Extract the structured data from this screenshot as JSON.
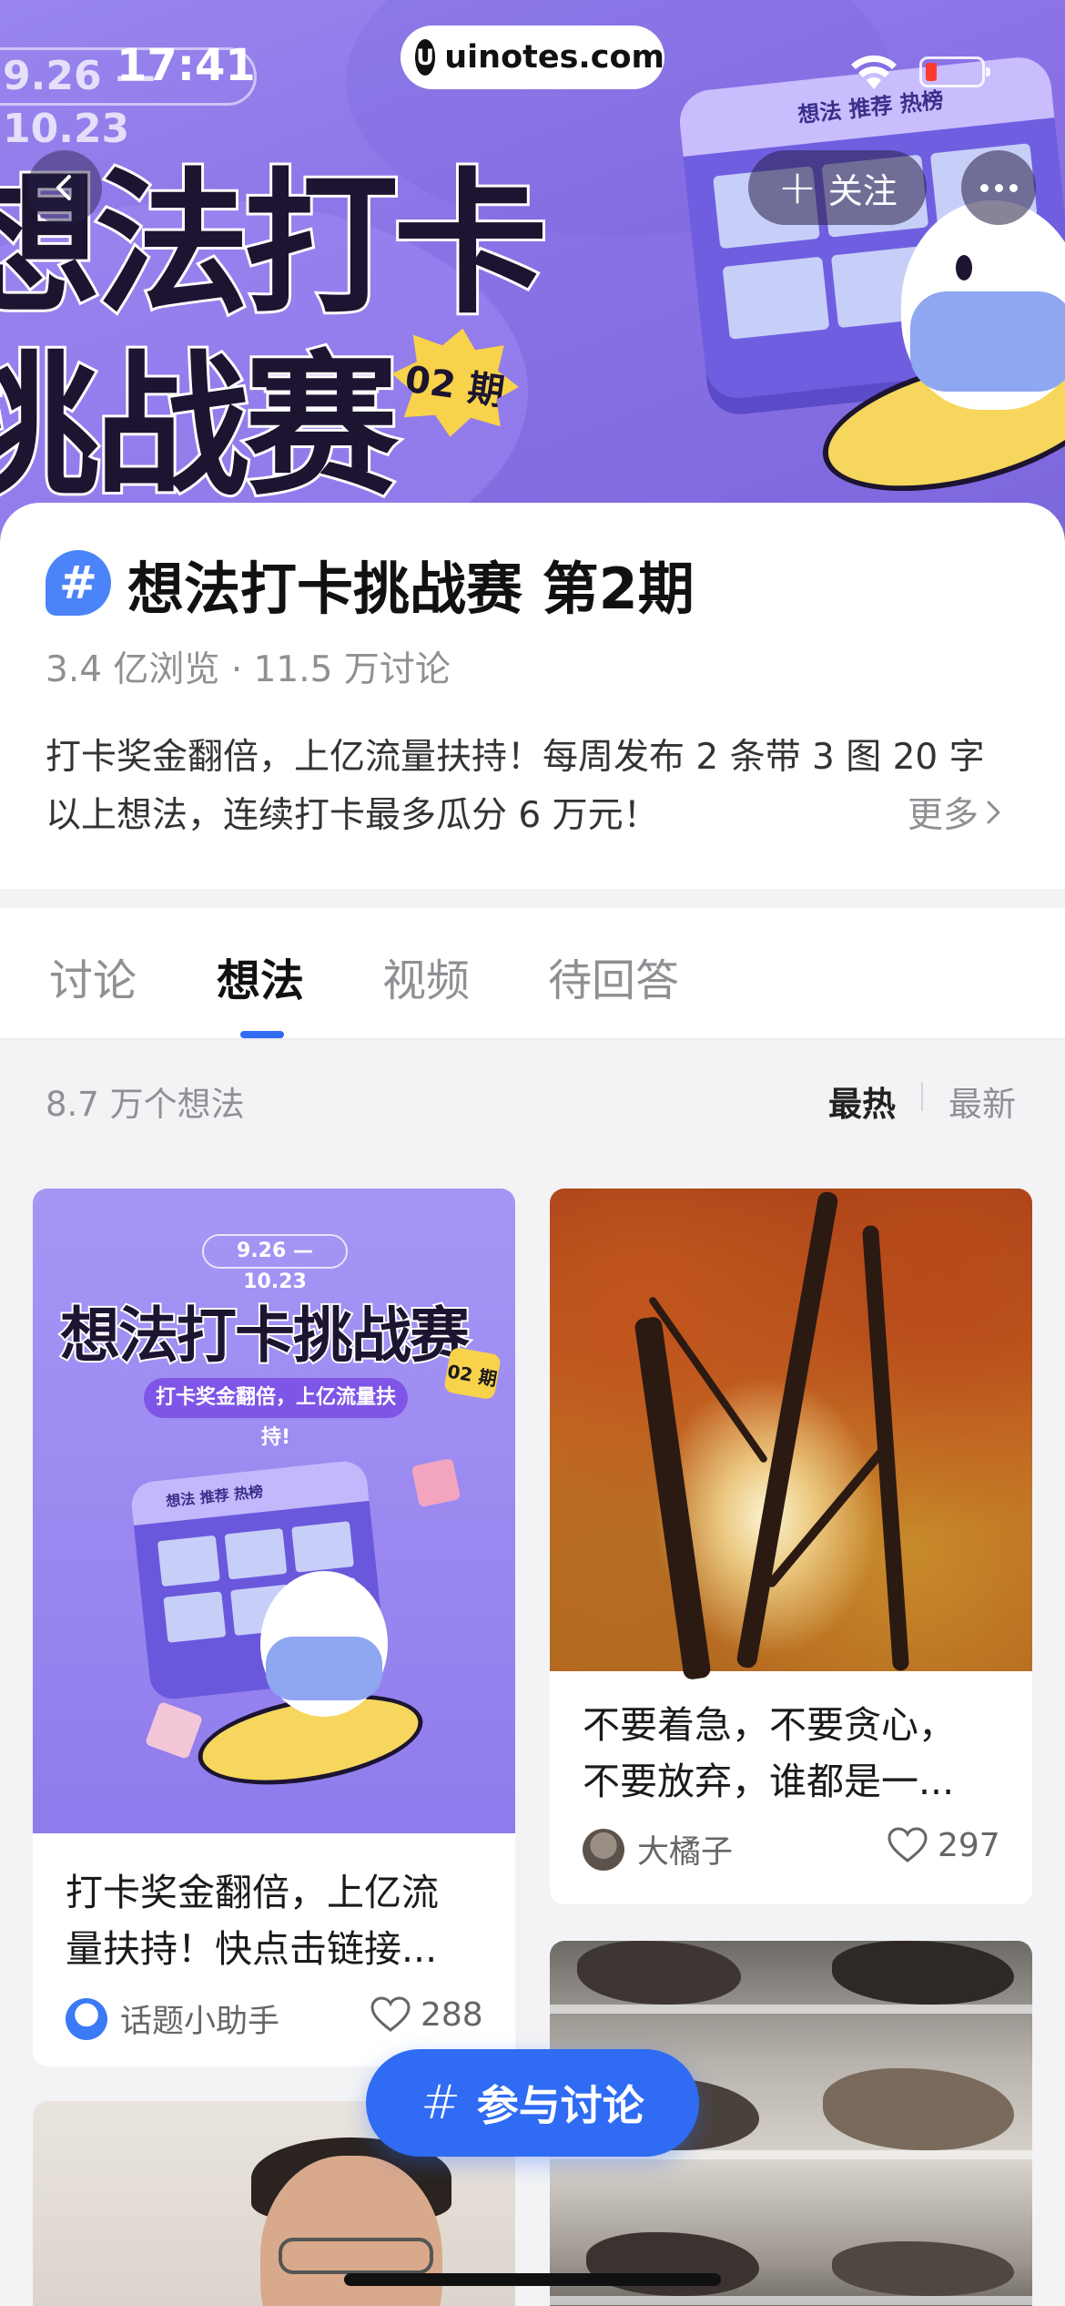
{
  "status_bar": {
    "time": "17:41",
    "url": "uinotes.com",
    "url_logo": "U"
  },
  "hero": {
    "date_range": "9.26 — 10.23",
    "title_line1": "想法打卡",
    "title_line2": "挑战赛",
    "issue_badge": "02 期",
    "calendar_tabs": "想法 推荐 热榜",
    "follow_label": "关注",
    "back_icon": "chevron-left-icon",
    "more_icon": "more-dots-icon"
  },
  "topic": {
    "icon_glyph": "#",
    "title": "想法打卡挑战赛 第2期",
    "stats": "3.4 亿浏览 · 11.5 万讨论",
    "description": "打卡奖金翻倍，上亿流量扶持！每周发布 2 条带 3 图 20 字以上想法，连续打卡最多瓜分 6 万元！",
    "more_label": "更多"
  },
  "tabs": [
    {
      "label": "讨论",
      "active": false
    },
    {
      "label": "想法",
      "active": true
    },
    {
      "label": "视频",
      "active": false
    },
    {
      "label": "待回答",
      "active": false
    }
  ],
  "feed": {
    "count": "8.7 万个想法",
    "sort_hot": "最热",
    "sort_new": "最新",
    "accent_color": "#2f6bf3"
  },
  "cards": [
    {
      "promo": {
        "date_range": "9.26 — 10.23",
        "title": "想法打卡挑战赛",
        "badge": "02 期",
        "tagline": "打卡奖金翻倍，上亿流量扶持!",
        "calendar_tabs": "想法 推荐 热榜"
      },
      "text": "打卡奖金翻倍，上亿流\n量扶持！快点击链接...",
      "author": "话题小助手",
      "likes": "288"
    },
    {
      "text": "不要着急，不要贪心，\n不要放弃，谁都是一...",
      "author": "大橘子",
      "likes": "297"
    }
  ],
  "fab": {
    "icon": "#",
    "label": "参与讨论"
  }
}
